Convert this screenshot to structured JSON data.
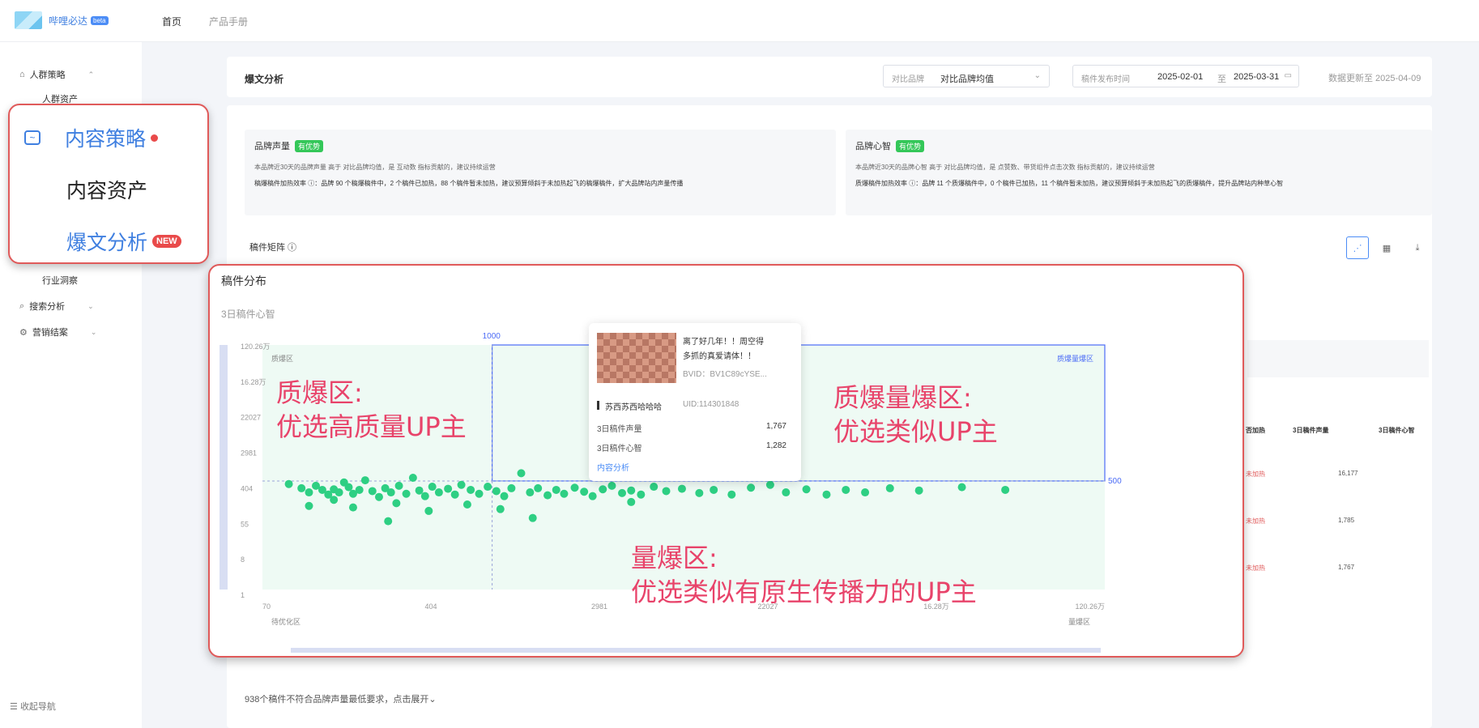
{
  "topbar": {
    "logo_text": "哔哩必达",
    "logo_badge": "beta",
    "nav": [
      "首页",
      "产品手册"
    ]
  },
  "sidebar": {
    "items": [
      {
        "label": "人群策略",
        "caret": "⌃"
      },
      {
        "label": "人群资产"
      },
      {
        "label": "行业洞察"
      },
      {
        "label": "搜索分析",
        "caret": "⌄"
      },
      {
        "label": "营销结案",
        "caret": "⌄"
      }
    ],
    "collapse": "收起导航",
    "highlight": {
      "strategy": "内容策略",
      "assets": "内容资产",
      "analysis": "爆文分析",
      "new_badge": "NEW"
    }
  },
  "header": {
    "title": "爆文分析",
    "compare_label": "对比品牌",
    "compare_value": "对比品牌均值",
    "date_label": "稿件发布时间",
    "date_start": "2025-02-01",
    "date_sep": "至",
    "date_end": "2025-03-31",
    "update_text": "数据更新至 2025-04-09"
  },
  "cards": [
    {
      "title": "品牌声量",
      "badge": "有优势",
      "line1": "本品牌近30天的品牌声量 高于 对比品牌均值，是 互动数 指标贡献的，建议持续运营",
      "line2": "稿爆稿件加热效率 ⓘ：品牌 90 个稿爆稿件中，2 个稿件已加热，88 个稿件暂未加热，建议预算倾斜于未加热起飞的稿爆稿件，扩大品牌站内声量传播"
    },
    {
      "title": "品牌心智",
      "badge": "有优势",
      "line1": "本品牌近30天的品牌心智 高于 对比品牌均值，是 点赞数、带货组件点击次数 指标贡献的，建议持续运营",
      "line2": "质爆稿件加热效率 ⓘ：品牌 11 个质爆稿件中，0 个稿件已加热，11 个稿件暂未加热，建议预算倾斜于未加热起飞的质爆稿件，提升品牌站内种草心智"
    }
  ],
  "matrix_label": "稿件矩阵 ⓘ",
  "chart": {
    "title": "稿件分布",
    "ylabel": "3日稿件心智",
    "y_ticks": [
      "120.26万",
      "16.28万",
      "22027",
      "2981",
      "404",
      "55",
      "8",
      "1"
    ],
    "x_ticks": [
      "70",
      "404",
      "2981",
      "22027",
      "16.28万",
      "120.26万"
    ],
    "x_threshold": "1000",
    "y_threshold": "500",
    "quadrants": {
      "tl": "质爆区",
      "tr": "质爆量爆区",
      "bl": "待优化区",
      "br": "量爆区"
    },
    "annot_tl": [
      "质爆区:",
      "优选高质量UP主"
    ],
    "annot_tr": [
      "质爆量爆区:",
      "优选类似UP主"
    ],
    "annot_b": [
      "量爆区:",
      "优选类似有原生传播力的UP主"
    ],
    "accent": "#2ecf83",
    "annot_color": "#e8436a"
  },
  "chart_data": {
    "type": "scatter",
    "title": "稿件分布",
    "ylabel": "3日稿件心智",
    "xlabel": "",
    "x_scale": "log",
    "y_scale": "log",
    "xlim": [
      70,
      1202600
    ],
    "ylim": [
      1,
      1202600
    ],
    "points": [
      [
        95,
        420
      ],
      [
        110,
        330
      ],
      [
        120,
        260
      ],
      [
        130,
        380
      ],
      [
        140,
        300
      ],
      [
        150,
        230
      ],
      [
        160,
        310
      ],
      [
        170,
        260
      ],
      [
        180,
        460
      ],
      [
        190,
        350
      ],
      [
        200,
        240
      ],
      [
        215,
        300
      ],
      [
        230,
        520
      ],
      [
        250,
        280
      ],
      [
        270,
        200
      ],
      [
        290,
        330
      ],
      [
        310,
        260
      ],
      [
        340,
        380
      ],
      [
        370,
        240
      ],
      [
        400,
        600
      ],
      [
        430,
        290
      ],
      [
        460,
        210
      ],
      [
        500,
        360
      ],
      [
        540,
        260
      ],
      [
        600,
        320
      ],
      [
        650,
        230
      ],
      [
        700,
        400
      ],
      [
        780,
        300
      ],
      [
        860,
        240
      ],
      [
        950,
        360
      ],
      [
        1050,
        280
      ],
      [
        1150,
        210
      ],
      [
        1250,
        330
      ],
      [
        1400,
        780
      ],
      [
        1550,
        260
      ],
      [
        1700,
        330
      ],
      [
        1900,
        220
      ],
      [
        2100,
        300
      ],
      [
        2300,
        240
      ],
      [
        2600,
        340
      ],
      [
        2900,
        270
      ],
      [
        3200,
        210
      ],
      [
        3600,
        310
      ],
      [
        4000,
        380
      ],
      [
        4500,
        250
      ],
      [
        5000,
        290
      ],
      [
        5600,
        230
      ],
      [
        6500,
        360
      ],
      [
        7500,
        280
      ],
      [
        9000,
        320
      ],
      [
        11000,
        250
      ],
      [
        13000,
        300
      ],
      [
        16000,
        230
      ],
      [
        20000,
        340
      ],
      [
        25000,
        400
      ],
      [
        30000,
        260
      ],
      [
        38000,
        310
      ],
      [
        48000,
        230
      ],
      [
        60000,
        300
      ],
      [
        75000,
        260
      ],
      [
        100000,
        330
      ],
      [
        140000,
        290
      ],
      [
        230000,
        350
      ],
      [
        380000,
        300
      ],
      [
        120,
        120
      ],
      [
        200,
        110
      ],
      [
        330,
        140
      ],
      [
        480,
        90
      ],
      [
        750,
        130
      ],
      [
        1100,
        100
      ],
      [
        1600,
        60
      ],
      [
        300,
        50
      ],
      [
        160,
        170
      ],
      [
        5000,
        150
      ]
    ]
  },
  "tooltip": {
    "title_line1": "离了好几年！！周空得",
    "title_line2": "多抓的真爱请体！！",
    "bvid": "BVID：BV1C89cYSE...",
    "author": "苏西苏西哈哈哈",
    "uid": "UID:114301848",
    "row1_label": "3日稿件声量",
    "row1_value": "1,767",
    "row2_label": "3日稿件心智",
    "row2_value": "1,282",
    "link": "内容分析"
  },
  "right_table": {
    "headers": [
      "否加热",
      "3日稿件声量",
      "3日稿件心智"
    ],
    "rows": [
      {
        "status": "未加热",
        "volume": "16,177"
      },
      {
        "status": "未加热",
        "volume": "1,785"
      },
      {
        "status": "未加热",
        "volume": "1,767"
      }
    ]
  },
  "bottom_note": "938个稿件不符合品牌声量最低要求，点击展开⌄"
}
